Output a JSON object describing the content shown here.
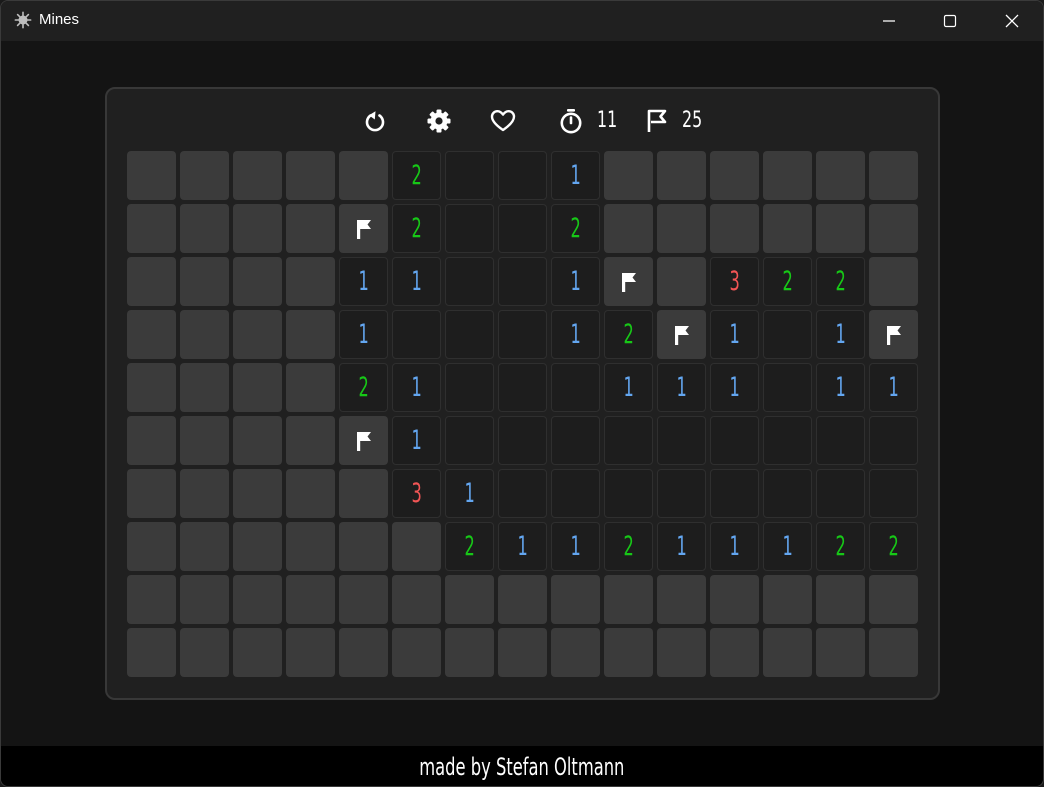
{
  "window": {
    "title": "Mines",
    "app_icon": "mines-icon"
  },
  "toolbar": {
    "restart_icon": "restart-icon",
    "settings_icon": "gear-icon",
    "favorite_icon": "heart-icon",
    "timer_icon": "stopwatch-icon",
    "timer_value": "11",
    "flags_icon": "flag-icon",
    "flags_value": "25"
  },
  "colors": {
    "1": "#63a6f0",
    "2": "#17c817",
    "3": "#f25555",
    "hidden": "#3b3b3b",
    "open": "#1d1d1d"
  },
  "board": {
    "columns": 15,
    "rows": 10,
    "legend": "H = hidden, O = open empty, F = flagged, digit = adjacent mine count",
    "cells": [
      [
        "H",
        "H",
        "H",
        "H",
        "H",
        "2",
        "O",
        "O",
        "1",
        "H",
        "H",
        "H",
        "H",
        "H",
        "H"
      ],
      [
        "H",
        "H",
        "H",
        "H",
        "F",
        "2",
        "O",
        "O",
        "2",
        "H",
        "H",
        "H",
        "H",
        "H",
        "H"
      ],
      [
        "H",
        "H",
        "H",
        "H",
        "1",
        "1",
        "O",
        "O",
        "1",
        "F",
        "H",
        "3",
        "2",
        "2",
        "H"
      ],
      [
        "H",
        "H",
        "H",
        "H",
        "1",
        "O",
        "O",
        "O",
        "1",
        "2",
        "F",
        "1",
        "O",
        "1",
        "F"
      ],
      [
        "H",
        "H",
        "H",
        "H",
        "2",
        "1",
        "O",
        "O",
        "O",
        "1",
        "1",
        "1",
        "O",
        "1",
        "1"
      ],
      [
        "H",
        "H",
        "H",
        "H",
        "F",
        "1",
        "O",
        "O",
        "O",
        "O",
        "O",
        "O",
        "O",
        "O",
        "O"
      ],
      [
        "H",
        "H",
        "H",
        "H",
        "H",
        "3",
        "1",
        "O",
        "O",
        "O",
        "O",
        "O",
        "O",
        "O",
        "O"
      ],
      [
        "H",
        "H",
        "H",
        "H",
        "H",
        "H",
        "2",
        "1",
        "1",
        "2",
        "1",
        "1",
        "1",
        "2",
        "2"
      ],
      [
        "H",
        "H",
        "H",
        "H",
        "H",
        "H",
        "H",
        "H",
        "H",
        "H",
        "H",
        "H",
        "H",
        "H",
        "H"
      ],
      [
        "H",
        "H",
        "H",
        "H",
        "H",
        "H",
        "H",
        "H",
        "H",
        "H",
        "H",
        "H",
        "H",
        "H",
        "H"
      ]
    ]
  },
  "footer": {
    "text": "made by Stefan Oltmann"
  }
}
